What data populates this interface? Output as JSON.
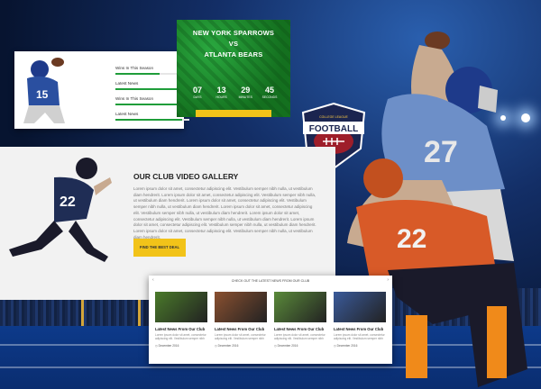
{
  "stats": [
    {
      "label": "Wins In This Season",
      "value": "60%",
      "pct": 60
    },
    {
      "label": "Latest News",
      "value": "90%",
      "pct": 90
    },
    {
      "label": "Wins In This Season",
      "value": "90%",
      "pct": 90
    },
    {
      "label": "Latest News",
      "value": "90%",
      "pct": 90
    }
  ],
  "match": {
    "team1": "NEW YORK SPARROWS",
    "vs": "VS",
    "team2": "ATLANTA BEARS",
    "countdown": [
      {
        "num": "07",
        "label": "DAYS"
      },
      {
        "num": "13",
        "label": "HOURS"
      },
      {
        "num": "29",
        "label": "MINUTES"
      },
      {
        "num": "45",
        "label": "SECONDS"
      }
    ],
    "ticket_label": "BUY TICKETS ON TICKETMASTER.COM"
  },
  "badge": {
    "top": "COLLEGE LEAGUE",
    "main": "FOOTBALL"
  },
  "gallery": {
    "title": "OUR CLUB VIDEO GALLERY",
    "text": "Lorem ipsum dolor sit amet, consectetur adipiscing elit. Vestibulum semper nibh nulla, ut vestibulum diam hendrerit. Lorem ipsum dolor sit amet, consectetur adipiscing elit. Vestibulum semper nibh nulla, ut vestibulum diam hendrerit. Lorem ipsum dolor sit amet, consectetur adipiscing elit. Vestibulum semper nibh nulla, ut vestibulum diam hendrerit. Lorem ipsum dolor sit amet, consectetur adipiscing elit. Vestibulum semper nibh nulla, ut vestibulum diam hendrerit. Lorem ipsum dolor sit amet, consectetur adipiscing elit. Vestibulum semper nibh nulla, ut vestibulum diam hendrerit. Lorem ipsum dolor sit amet, consectetur adipiscing elit. Vestibulum semper nibh nulla, ut vestibulum diam hendrerit. Lorem ipsum dolor sit amet, consectetur adipiscing elit. Vestibulum semper nibh nulla, ut vestibulum diam hendrerit.",
    "button": "FIND THE BEST DEAL"
  },
  "news": {
    "heading": "CHECK OUT THE LATEST NEWS FROM OUR CLUB",
    "prev": "‹",
    "next": "›",
    "items": [
      {
        "title": "Latest News From Our Club",
        "text": "Lorem ipsum dolor sit amet, consectetur adipiscing elit. Vestibulum semper nibh",
        "date": "◷ December 2016",
        "color": "#4a7a2a"
      },
      {
        "title": "Latest News From Our Club",
        "text": "Lorem ipsum dolor sit amet, consectetur adipiscing elit. Vestibulum semper nibh",
        "date": "◷ December 2016",
        "color": "#8a5030"
      },
      {
        "title": "Latest News From Our Club",
        "text": "Lorem ipsum dolor sit amet, consectetur adipiscing elit. Vestibulum semper nibh",
        "date": "◷ December 2016",
        "color": "#5a8a3a"
      },
      {
        "title": "Latest News From Our Club",
        "text": "Lorem ipsum dolor sit amet, consectetur adipiscing elit. Vestibulum semper nibh",
        "date": "◷ December 2016",
        "color": "#3a5a9a"
      }
    ]
  },
  "colors": {
    "accent": "#f2c319",
    "green": "#1f9d3a",
    "navy": "#0b1a3a"
  }
}
